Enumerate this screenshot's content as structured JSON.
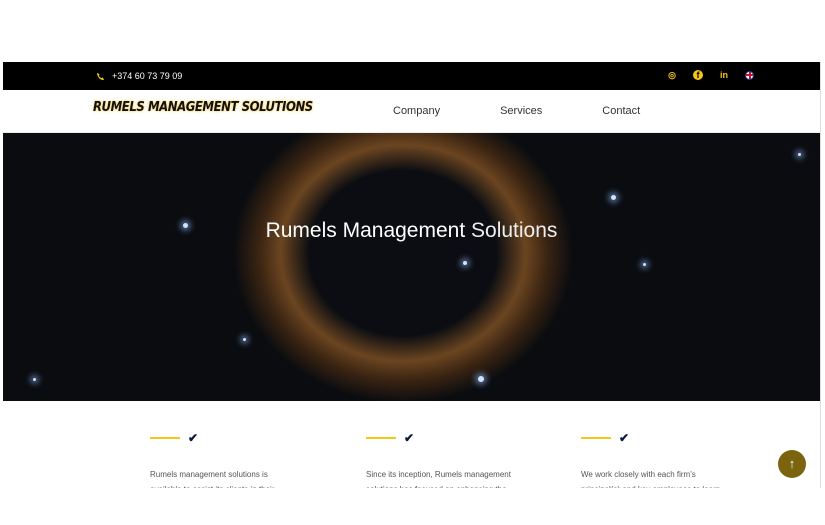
{
  "topbar": {
    "phone": "+374 60 73 79 09",
    "social": [
      {
        "icon": "instagram-icon",
        "glyph": "◎"
      },
      {
        "icon": "facebook-icon",
        "glyph": "f"
      },
      {
        "icon": "linkedin-icon",
        "glyph": "in"
      }
    ],
    "language_icon": "uk-flag-icon"
  },
  "header": {
    "logo": "RUMELS MANAGEMENT SOLUTIONS",
    "nav": [
      "Company",
      "Services",
      "Contact"
    ]
  },
  "hero": {
    "title_bold": "Rumels Management",
    "title_light": "Solutions"
  },
  "features": [
    {
      "text": "Rumels management solutions is available to assist its clients in their operational,"
    },
    {
      "text": "Since its inception, Rumels management solutions has focused on enhancing the"
    },
    {
      "text": "We work closely with each firm's principal(s) and key employees to learn"
    }
  ],
  "scroll_top": "↑",
  "colors": {
    "accent": "#f5c518",
    "scroll_button": "#7a640e"
  }
}
